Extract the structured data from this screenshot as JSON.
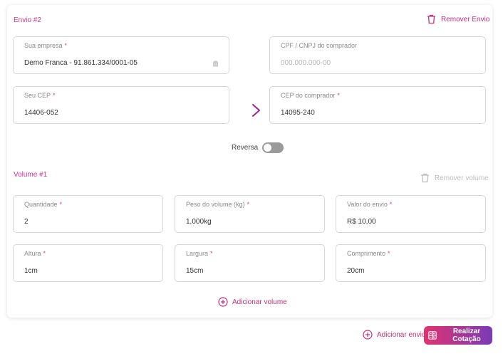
{
  "envio": {
    "title": "Envio #2",
    "remove_label": "Remover Envio",
    "fields": {
      "empresa": {
        "label": "Sua empresa",
        "value": "Demo Franca - 91.861.334/0001-05"
      },
      "cpf": {
        "label": "CPF / CNPJ do comprador",
        "placeholder": "000.000.000-00"
      },
      "cep_origem": {
        "label": "Seu CEP",
        "value": "14406-052"
      },
      "cep_destino": {
        "label": "CEP do comprador",
        "value": "14095-240"
      }
    },
    "reversa": {
      "label": "Reversa",
      "enabled": false
    }
  },
  "volume": {
    "title": "Volume #1",
    "remove_label": "Remover volume",
    "fields": {
      "quantidade": {
        "label": "Quantidade",
        "value": "2"
      },
      "peso": {
        "label": "Peso do volume (kg)",
        "value": "1,000kg"
      },
      "valor": {
        "label": "Valor do envio",
        "value": "R$ 10,00"
      },
      "altura": {
        "label": "Altura",
        "value": "1cm"
      },
      "largura": {
        "label": "Largura",
        "value": "15cm"
      },
      "comprimento": {
        "label": "Comprimento",
        "value": "20cm"
      }
    },
    "add_label": "Adicionar volume"
  },
  "footer": {
    "add_envio_label": "Adicionar envio",
    "submit_label": "Realizar Cotação"
  },
  "required_mark": "*",
  "colors": {
    "accent": "#c42f7c",
    "required": "#e2445c",
    "cta_gradient_start": "#e2336e",
    "cta_gradient_end": "#7a3ab8"
  },
  "icons": {
    "remove": "trash-icon",
    "add": "plus-circle-icon",
    "arrow": "chevron-right-icon",
    "company_field": "building-icon",
    "submit": "calculator-icon"
  }
}
